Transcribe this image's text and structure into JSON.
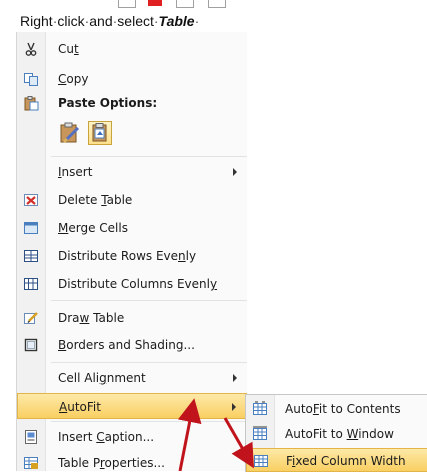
{
  "instruction": {
    "prefix": "Right",
    "w1": "click",
    "w2": "and",
    "w3": "select",
    "emphasis": "Table",
    "dot": "·"
  },
  "menu": {
    "items": [
      {
        "label_pre": "Cu",
        "label_u": "t",
        "label_post": "",
        "icon": "scissors-icon"
      },
      {
        "label_pre": "",
        "label_u": "C",
        "label_post": "opy",
        "icon": "copy-icon"
      },
      {
        "label": "Paste Options:",
        "icon": "paste-icon"
      },
      {
        "label_pre": "",
        "label_u": "I",
        "label_post": "nsert",
        "icon": "none"
      },
      {
        "label_pre": "Delete ",
        "label_u": "T",
        "label_post": "able",
        "icon": "delete-table-icon"
      },
      {
        "label_pre": "",
        "label_u": "M",
        "label_post": "erge Cells",
        "icon": "merge-cells-icon"
      },
      {
        "label_pre": "Distribute Rows Eve",
        "label_u": "n",
        "label_post": "ly",
        "icon": "distribute-rows-icon"
      },
      {
        "label_pre": "Distribute Columns Evenl",
        "label_u": "y",
        "label_post": "",
        "icon": "distribute-columns-icon"
      },
      {
        "label_pre": "Dra",
        "label_u": "w",
        "label_post": " Table",
        "icon": "draw-table-icon"
      },
      {
        "label_pre": "",
        "label_u": "B",
        "label_post": "orders and Shading...",
        "icon": "borders-icon"
      },
      {
        "label_pre": "Cell Ali",
        "label_u": "g",
        "label_post": "nment",
        "icon": "none"
      },
      {
        "label_pre": "",
        "label_u": "A",
        "label_post": "utoFit",
        "icon": "none"
      },
      {
        "label_pre": "Insert ",
        "label_u": "C",
        "label_post": "aption...",
        "icon": "caption-icon"
      },
      {
        "label_pre": "Table P",
        "label_u": "r",
        "label_post": "operties...",
        "icon": "table-properties-icon"
      }
    ]
  },
  "submenu": {
    "items": [
      {
        "label_pre": "Auto",
        "label_u": "F",
        "label_post": "it to Contents",
        "icon": "autofit-contents-icon"
      },
      {
        "label_pre": "AutoFit to ",
        "label_u": "W",
        "label_post": "indow",
        "icon": "autofit-window-icon"
      },
      {
        "label_pre": "F",
        "label_u": "i",
        "label_post": "xed Column Width",
        "icon": "fixed-width-icon"
      }
    ]
  },
  "colors": {
    "hover": "#f9cf62",
    "arrow": "#c0131b"
  }
}
